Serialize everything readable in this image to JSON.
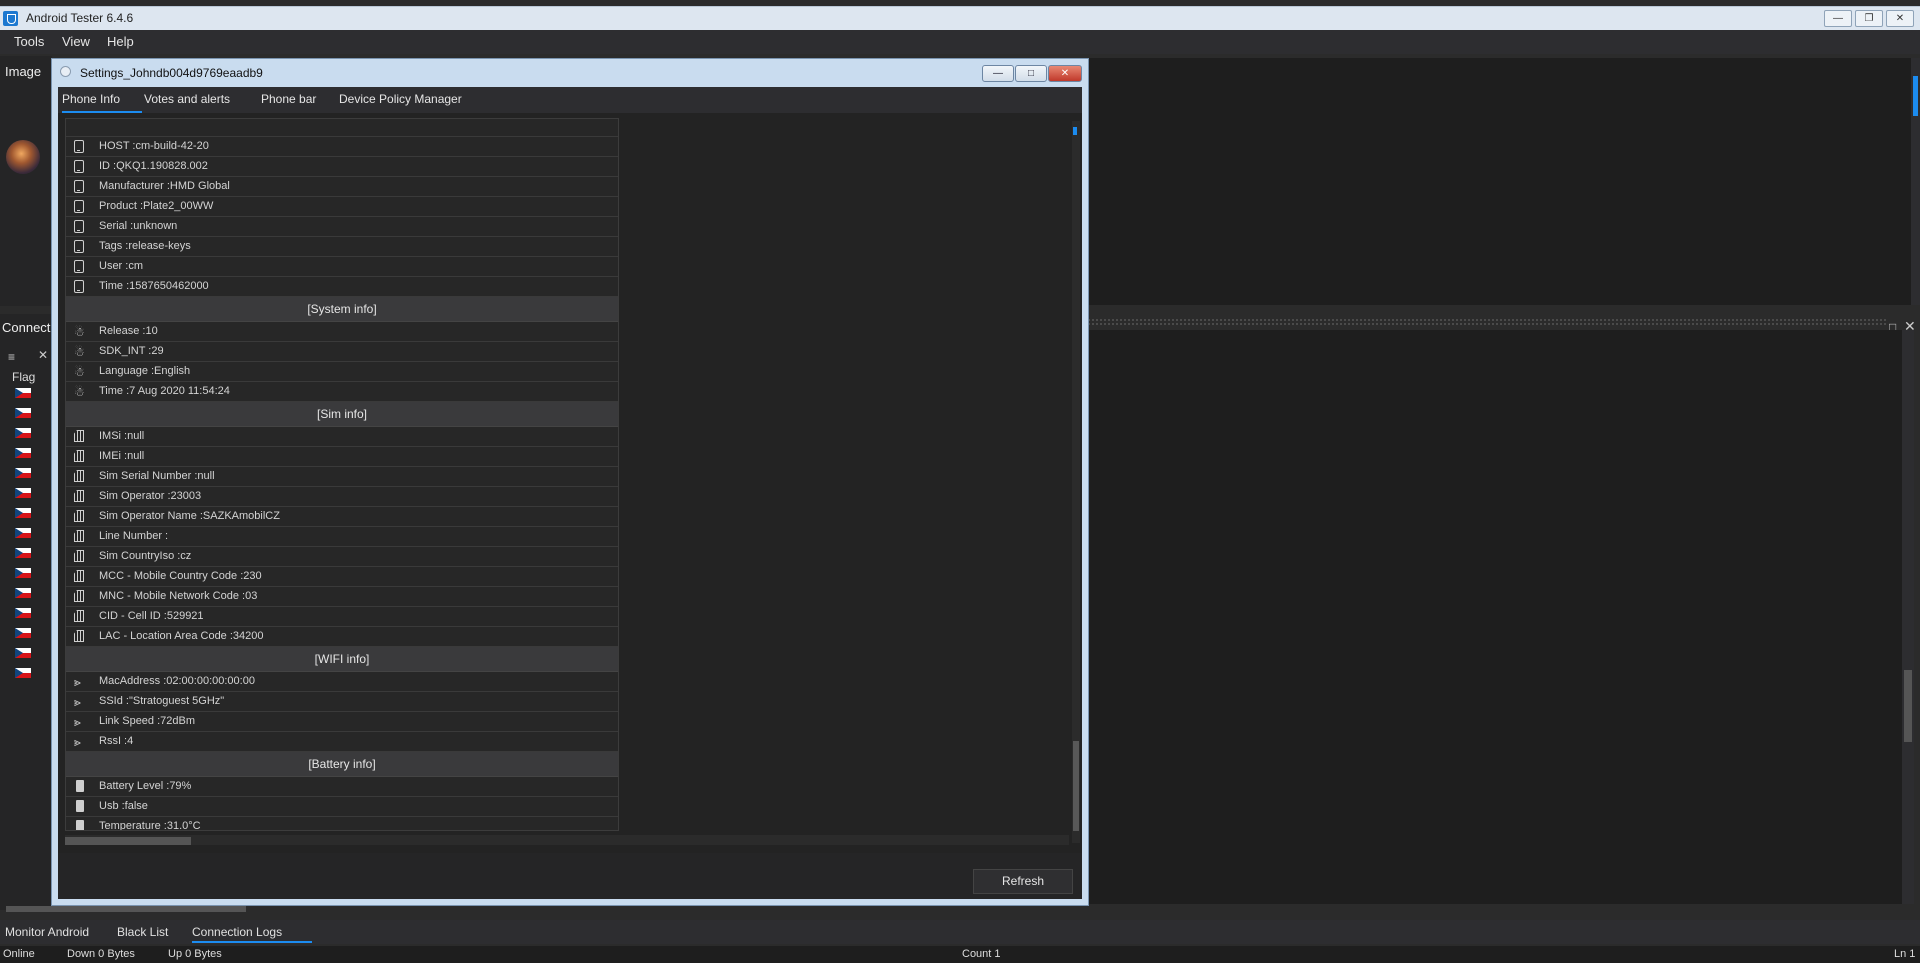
{
  "window": {
    "title": "Android Tester 6.4.6",
    "min": "—",
    "restore": "❐",
    "close": "✕"
  },
  "menu": [
    "Tools",
    "View",
    "Help"
  ],
  "left_panels": {
    "image_label": "Image",
    "connection_label": "Connectio",
    "flag_header": "Flag",
    "flag_count": 15
  },
  "dialog": {
    "title": "Settings_Johndb004d9769eaadb9",
    "tabs": [
      "Phone Info",
      "Votes and alerts",
      "Phone bar",
      "Device Policy Manager"
    ],
    "active_tab": "Phone Info",
    "refresh_label": "Refresh"
  },
  "phone_info": {
    "device_rows": [
      "HOST :cm-build-42-20",
      "ID :QKQ1.190828.002",
      "Manufacturer :HMD Global",
      "Product :Plate2_00WW",
      "Serial :unknown",
      "Tags :release-keys",
      "User :cm",
      "Time :1587650462000"
    ],
    "system_header": "[System info]",
    "system_rows": [
      "Release :10",
      "SDK_INT :29",
      "Language :English",
      "Time :7 Aug 2020 11:54:24"
    ],
    "sim_header": "[Sim info]",
    "sim_rows": [
      "IMSi :null",
      "IMEi :null",
      "Sim Serial Number :null",
      "Sim Operator :23003",
      "Sim Operator Name :SAZKAmobilCZ",
      "Line Number :",
      "Sim CountryIso :cz",
      "MCC - Mobile Country Code :230",
      "MNC - Mobile Network Code :03",
      "CID - Cell ID :529921",
      "LAC - Location Area Code :34200"
    ],
    "wifi_header": "[WIFI info]",
    "wifi_rows": [
      "MacAddress :02:00:00:00:00:00",
      "SSId :\"Stratoguest 5GHz\"",
      "Link Speed :72dBm",
      "RssI :4"
    ],
    "battery_header": "[Battery info]",
    "battery_rows": [
      "Battery Level :79%",
      "Usb :false",
      "Temperature :31.0°C"
    ]
  },
  "bottom_tabs": [
    "Monitor Android",
    "Black List",
    "Connection Logs"
  ],
  "active_bottom_tab": "Connection Logs",
  "status": {
    "online": "Online",
    "down": "Down 0 Bytes",
    "up": "Up 0 Bytes",
    "count": "Count 1",
    "line": "Ln 1"
  },
  "colors": {
    "accent": "#1c8cf0",
    "background": "#252526",
    "dialog_frame": "#c9dcef",
    "close_button": "#c0392b"
  }
}
